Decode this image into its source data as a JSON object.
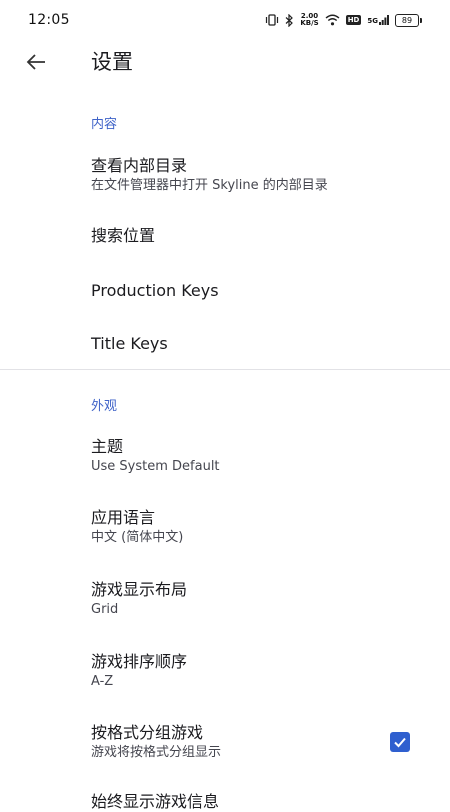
{
  "status_bar": {
    "time": "12:05",
    "net_speed_value": "2.00",
    "net_speed_unit": "KB/S",
    "hd_label": "HD",
    "signal_label": "5G",
    "battery": "89"
  },
  "app_bar": {
    "title": "设置"
  },
  "sections": {
    "content": {
      "header": "内容",
      "view_internal_dir": {
        "title": "查看内部目录",
        "summary": "在文件管理器中打开 Skyline 的内部目录"
      },
      "search_location": {
        "title": "搜索位置"
      },
      "production_keys": {
        "title": "Production Keys"
      },
      "title_keys": {
        "title": "Title Keys"
      }
    },
    "appearance": {
      "header": "外观",
      "theme": {
        "title": "主题",
        "summary": "Use System Default"
      },
      "app_language": {
        "title": "应用语言",
        "summary": "中文 (简体中文)"
      },
      "game_layout": {
        "title": "游戏显示布局",
        "summary": "Grid"
      },
      "game_sort": {
        "title": "游戏排序顺序",
        "summary": "A-Z"
      },
      "group_by_format": {
        "title": "按格式分组游戏",
        "summary": "游戏将按格式分组显示",
        "checked": true
      },
      "show_game_info": {
        "title": "始终显示游戏信息"
      }
    }
  },
  "colors": {
    "accent": "#3f63c8",
    "checkbox": "#2f5fcf",
    "divider": "#e2e2e6"
  },
  "icons": {
    "back": "arrow-back-icon",
    "vibrate": "vibrate-icon",
    "bluetooth": "bluetooth-icon",
    "wifi": "wifi-icon",
    "check": "check-icon"
  }
}
